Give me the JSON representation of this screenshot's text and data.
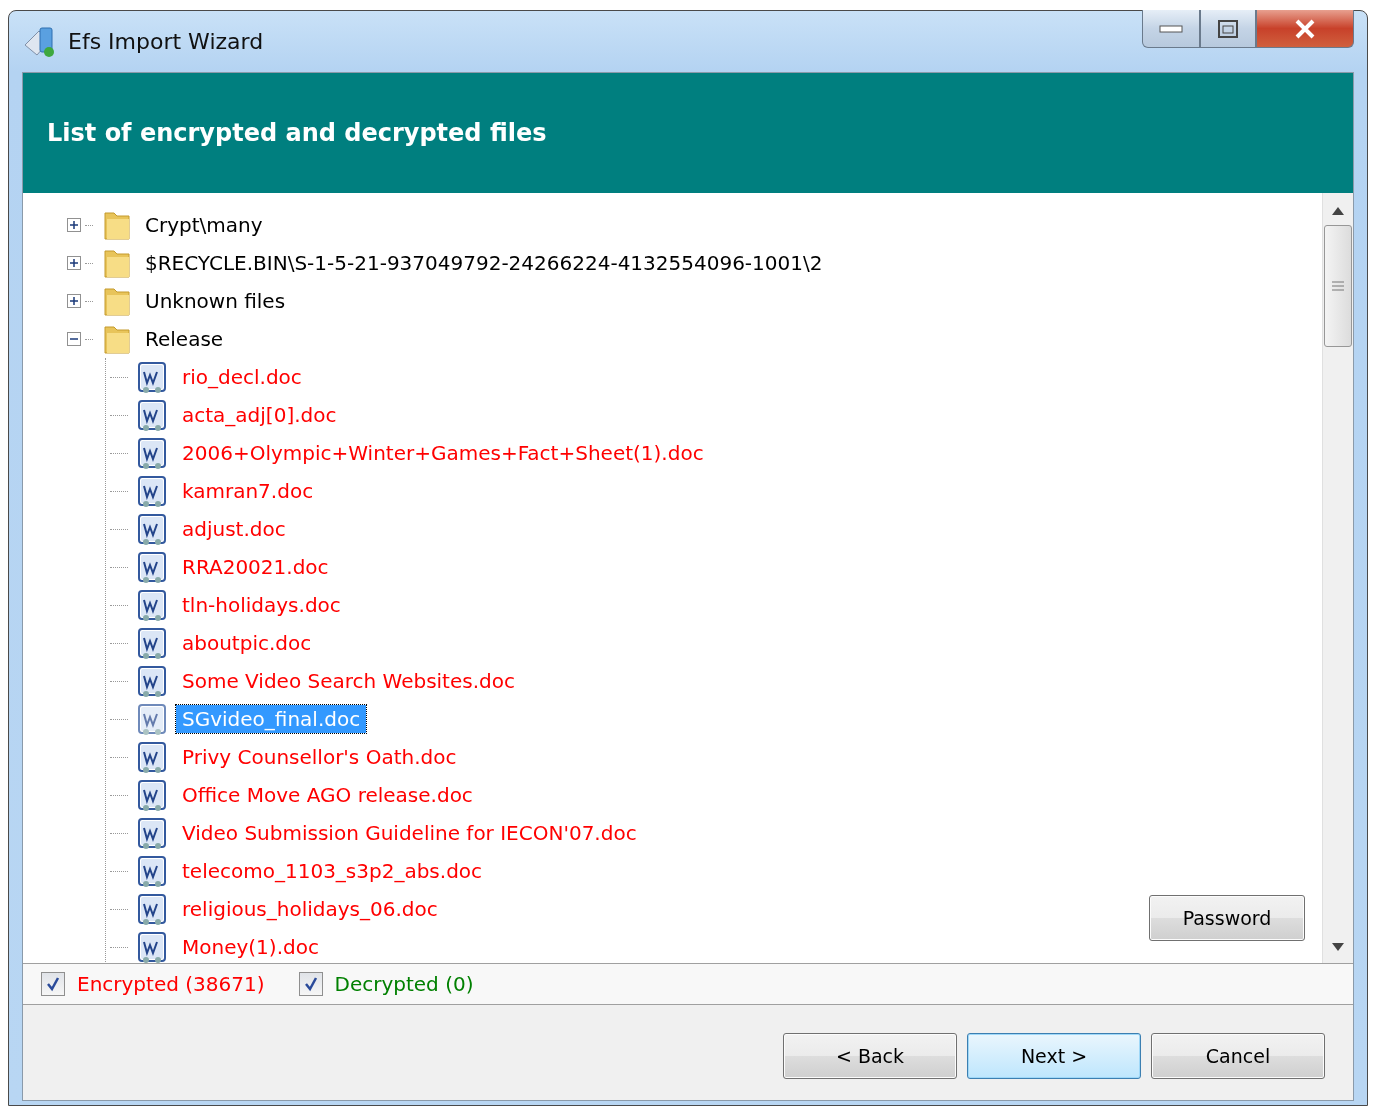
{
  "window": {
    "title": "Efs Import Wizard"
  },
  "header": {
    "title": "List of encrypted and decrypted files"
  },
  "tree": [
    {
      "kind": "folder",
      "label": "Crypt\\many",
      "expanded": false
    },
    {
      "kind": "folder",
      "label": "$RECYCLE.BIN\\S-1-5-21-937049792-24266224-4132554096-1001\\2",
      "expanded": false
    },
    {
      "kind": "folder",
      "label": "Unknown files",
      "expanded": false
    },
    {
      "kind": "folder",
      "label": "Release",
      "expanded": true,
      "children": [
        {
          "kind": "file",
          "label": "rio_decl.doc",
          "encrypted": true,
          "selected": false
        },
        {
          "kind": "file",
          "label": "acta_adj[0].doc",
          "encrypted": true,
          "selected": false
        },
        {
          "kind": "file",
          "label": "2006+Olympic+Winter+Games+Fact+Sheet(1).doc",
          "encrypted": true,
          "selected": false
        },
        {
          "kind": "file",
          "label": "kamran7.doc",
          "encrypted": true,
          "selected": false
        },
        {
          "kind": "file",
          "label": "adjust.doc",
          "encrypted": true,
          "selected": false
        },
        {
          "kind": "file",
          "label": "RRA20021.doc",
          "encrypted": true,
          "selected": false
        },
        {
          "kind": "file",
          "label": "tln-holidays.doc",
          "encrypted": true,
          "selected": false
        },
        {
          "kind": "file",
          "label": "aboutpic.doc",
          "encrypted": true,
          "selected": false
        },
        {
          "kind": "file",
          "label": "Some Video Search Websites.doc",
          "encrypted": true,
          "selected": false
        },
        {
          "kind": "file",
          "label": "SGvideo_final.doc",
          "encrypted": true,
          "selected": true
        },
        {
          "kind": "file",
          "label": "Privy Counsellor's Oath.doc",
          "encrypted": true,
          "selected": false
        },
        {
          "kind": "file",
          "label": "Office Move AGO release.doc",
          "encrypted": true,
          "selected": false
        },
        {
          "kind": "file",
          "label": "Video Submission Guideline for IECON'07.doc",
          "encrypted": true,
          "selected": false
        },
        {
          "kind": "file",
          "label": "telecomo_1103_s3p2_abs.doc",
          "encrypted": true,
          "selected": false
        },
        {
          "kind": "file",
          "label": "religious_holidays_06.doc",
          "encrypted": true,
          "selected": false
        },
        {
          "kind": "file",
          "label": "Money(1).doc",
          "encrypted": true,
          "selected": false
        }
      ]
    }
  ],
  "password_button": "Password",
  "filters": [
    {
      "kind": "encrypted",
      "label": "Encrypted (38671)",
      "checked": true
    },
    {
      "kind": "decrypted",
      "label": "Decrypted (0)",
      "checked": true
    }
  ],
  "buttons": [
    {
      "label": "< Back",
      "default": false
    },
    {
      "label": "Next >",
      "default": true
    },
    {
      "label": "Cancel",
      "default": false
    }
  ]
}
